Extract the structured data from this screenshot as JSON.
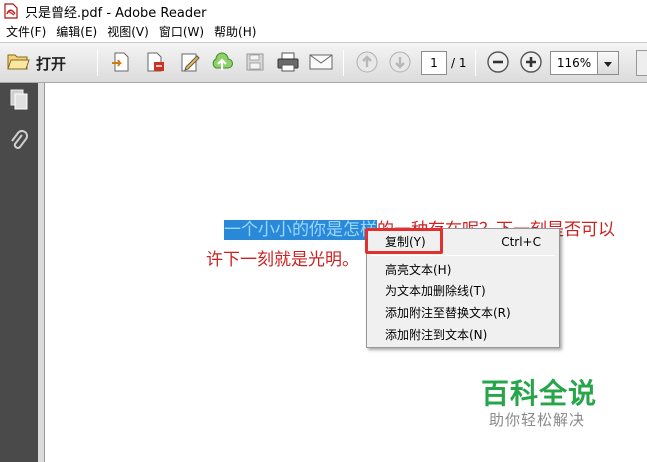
{
  "window": {
    "title": "只是曾经.pdf - Adobe Reader"
  },
  "menubar": {
    "items": [
      "文件(F)",
      "编辑(E)",
      "视图(V)",
      "窗口(W)",
      "帮助(H)"
    ]
  },
  "toolbar": {
    "open_label": "打开",
    "page_current": "1",
    "page_total": "/ 1",
    "zoom": "116%",
    "icons": [
      "folder-icon",
      "create-pdf-icon",
      "export-pdf-icon",
      "edit-icon",
      "upload-cloud-icon",
      "save-icon",
      "print-icon",
      "email-icon",
      "prev-page-icon",
      "next-page-icon",
      "zoom-out-icon",
      "zoom-in-icon"
    ]
  },
  "document": {
    "line1_selected": "一个小小的你是怎样",
    "line1_rest": "的一种存在呢？下一刻是否可以",
    "line2": "许下一刻就是光明。"
  },
  "context_menu": {
    "items": [
      {
        "label": "复制(Y)",
        "shortcut": "Ctrl+C"
      },
      {
        "label": "高亮文本(H)"
      },
      {
        "label": "为文本加删除线(T)"
      },
      {
        "label": "添加附注至替换文本(R)"
      },
      {
        "label": "添加附注到文本(N)"
      }
    ]
  },
  "watermark": {
    "title": "百科全说",
    "subtitle": "助你轻松解决"
  },
  "colors": {
    "text_red": "#cc2222",
    "selection": "#2a88d8",
    "highlight_box": "#e03030",
    "watermark_green": "#27a54a"
  }
}
